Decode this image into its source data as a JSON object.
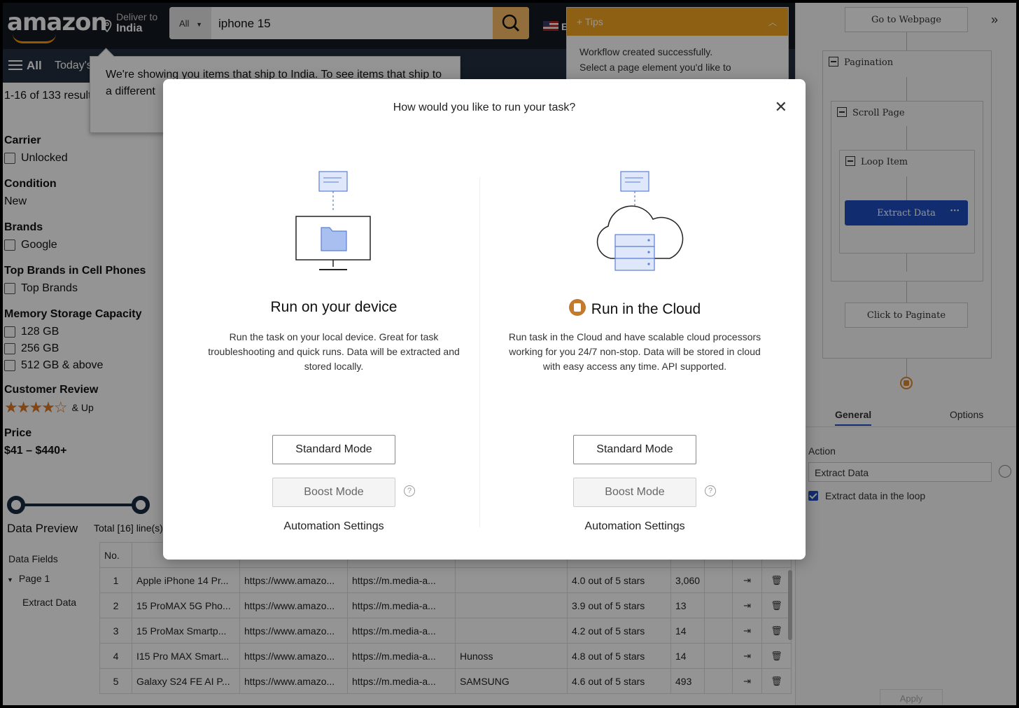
{
  "amazon": {
    "logo": "amazon",
    "deliver_label": "Deliver to",
    "deliver_location": "India",
    "search_category": "All",
    "search_query": "iphone 15",
    "nav_all": "All",
    "nav_today": "Today's",
    "lang_letter": "E",
    "ship_notice": "We're showing you items that ship to India. To see items that ship to a different",
    "results_count": "1-16 of 133 results"
  },
  "filters": {
    "carrier_heading": "Carrier",
    "carrier_unlocked": "Unlocked",
    "condition_heading": "Condition",
    "condition_new": "New",
    "brands_heading": "Brands",
    "brands_google": "Google",
    "top_brands_heading": "Top Brands in Cell Phones",
    "top_brands_item": "Top Brands",
    "memory_heading": "Memory Storage Capacity",
    "memory_128": "128 GB",
    "memory_256": "256 GB",
    "memory_512": "512 GB & above",
    "review_heading": "Customer Review",
    "review_rating_stars": 4,
    "review_up": "& Up",
    "price_heading": "Price",
    "price_range": "$41 – $440+"
  },
  "tips": {
    "title": "Tips",
    "line1": "Workflow created successfully.",
    "line2": "Select a page element you'd like to"
  },
  "data_preview": {
    "title": "Data Preview",
    "total": "Total [16] line(s)",
    "side_fields": "Data Fields",
    "side_page": "Page 1",
    "side_extract": "Extract Data",
    "col_no": "No.",
    "rows": [
      {
        "no": "1",
        "name": "Apple iPhone 14 Pr...",
        "url": "https://www.amazo...",
        "img": "https://m.media-a...",
        "brand": "",
        "rating": "4.0 out of 5 stars",
        "count": "3,060"
      },
      {
        "no": "2",
        "name": "15 ProMAX 5G Pho...",
        "url": "https://www.amazo...",
        "img": "https://m.media-a...",
        "brand": "",
        "rating": "3.9 out of 5 stars",
        "count": "13"
      },
      {
        "no": "3",
        "name": "15 ProMax Smartp...",
        "url": "https://www.amazo...",
        "img": "https://m.media-a...",
        "brand": "",
        "rating": "4.2 out of 5 stars",
        "count": "14"
      },
      {
        "no": "4",
        "name": "I15 Pro MAX Smart...",
        "url": "https://www.amazo...",
        "img": "https://m.media-a...",
        "brand": "Hunoss",
        "rating": "4.8 out of 5 stars",
        "count": "14"
      },
      {
        "no": "5",
        "name": "Galaxy S24 FE AI P...",
        "url": "https://www.amazo...",
        "img": "https://m.media-a...",
        "brand": "SAMSUNG",
        "rating": "4.6 out of 5 stars",
        "count": "493"
      }
    ]
  },
  "workflow": {
    "go_to_webpage": "Go to Webpage",
    "pagination": "Pagination",
    "scroll_page": "Scroll Page",
    "loop_item": "Loop Item",
    "extract_data": "Extract Data",
    "click_paginate": "Click to Paginate",
    "tab_general": "General",
    "tab_options": "Options",
    "action_label": "Action",
    "action_value": "Extract Data",
    "loop_checkbox": "Extract data in the loop",
    "apply": "Apply"
  },
  "modal": {
    "title": "How would you like to run your task?",
    "local": {
      "title": "Run on your device",
      "desc": "Run the task on your local device. Great for task troubleshooting and quick runs. Data will be extracted and stored locally.",
      "standard": "Standard Mode",
      "boost": "Boost Mode",
      "settings": "Automation Settings"
    },
    "cloud": {
      "title": "Run in the Cloud",
      "desc": "Run task in the Cloud and have scalable cloud processors working for you 24/7 non-stop. Data will be stored in cloud with easy access any time. API supported.",
      "standard": "Standard Mode",
      "boost": "Boost Mode",
      "settings": "Automation Settings"
    },
    "help_glyph": "?"
  },
  "colors": {
    "accent": "#1e4fbf",
    "amazon_dark": "#131921",
    "amazon_orange": "#febd69",
    "badge": "#c37a2c"
  }
}
